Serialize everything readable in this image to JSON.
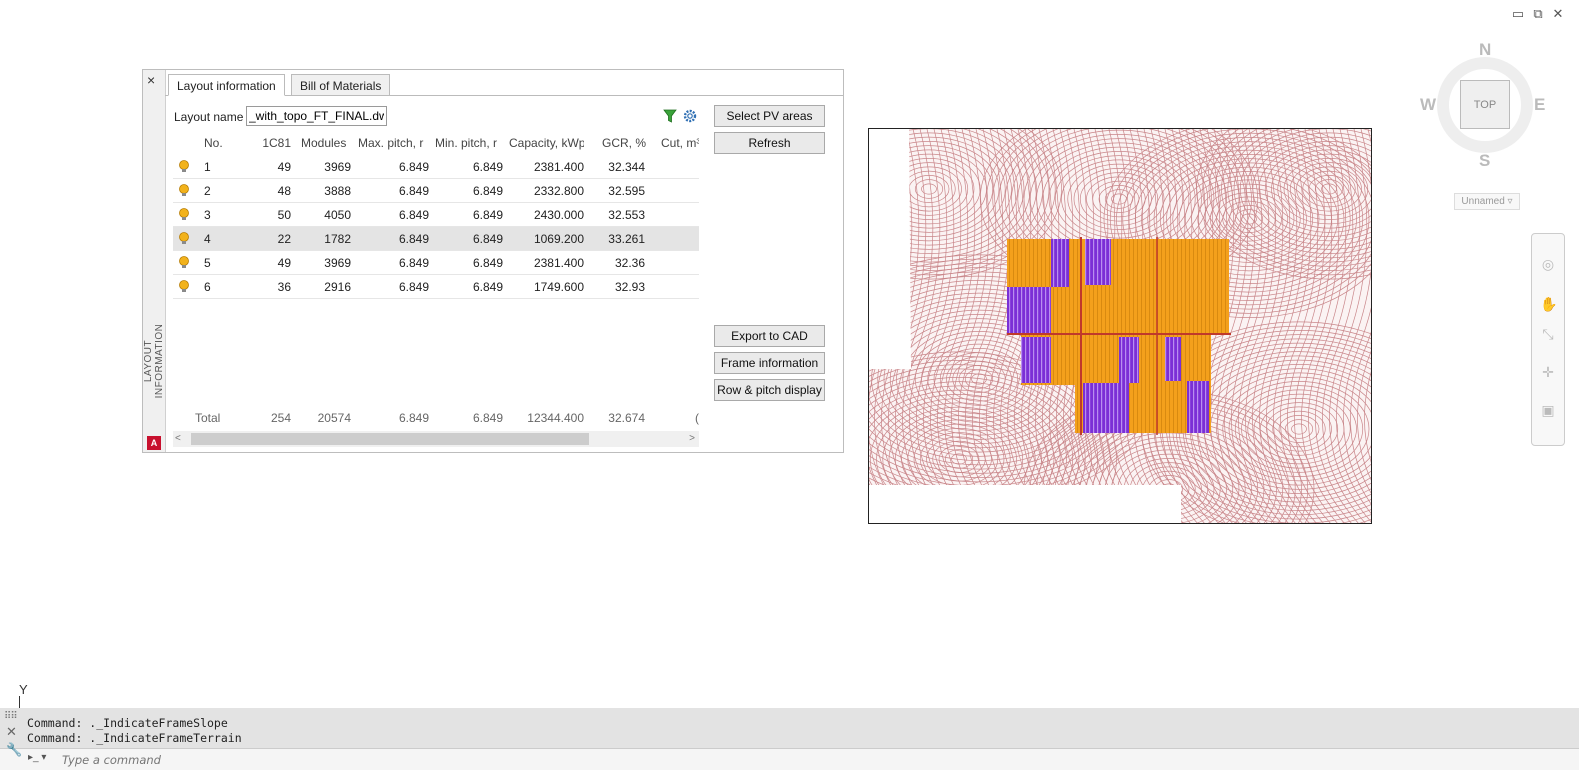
{
  "window_controls": {
    "minimize": "▭",
    "restore": "⧉",
    "close": "✕"
  },
  "palette": {
    "close_glyph": "×",
    "side_title": "LAYOUT INFORMATION",
    "logo": "A",
    "tabs": [
      {
        "label": "Layout information"
      },
      {
        "label": "Bill of Materials"
      }
    ],
    "layout_name_label": "Layout name",
    "layout_name_value": "_with_topo_FT_FINAL.dwg",
    "buttons": {
      "select_pv_areas": "Select PV areas",
      "refresh": "Refresh",
      "export_to_cad": "Export to CAD",
      "frame_information": "Frame information",
      "row_pitch_display": "Row & pitch display"
    },
    "table": {
      "columns": [
        "No.",
        "1C81",
        "Modules",
        "Max. pitch, r",
        "Min. pitch, r",
        "Capacity, kWp",
        "GCR, %",
        "Cut, m³"
      ],
      "rows": [
        [
          "1",
          "49",
          "3969",
          "6.849",
          "6.849",
          "2381.400",
          "32.344"
        ],
        [
          "2",
          "48",
          "3888",
          "6.849",
          "6.849",
          "2332.800",
          "32.595"
        ],
        [
          "3",
          "50",
          "4050",
          "6.849",
          "6.849",
          "2430.000",
          "32.553"
        ],
        [
          "4",
          "22",
          "1782",
          "6.849",
          "6.849",
          "1069.200",
          "33.261"
        ],
        [
          "5",
          "49",
          "3969",
          "6.849",
          "6.849",
          "2381.400",
          "32.36"
        ],
        [
          "6",
          "36",
          "2916",
          "6.849",
          "6.849",
          "1749.600",
          "32.93"
        ]
      ],
      "total": [
        "Total",
        "254",
        "20574",
        "6.849",
        "6.849",
        "12344.400",
        "32.674",
        "("
      ]
    },
    "scroll_left": "<",
    "scroll_right": ">"
  },
  "viewcube": {
    "north": "N",
    "south": "S",
    "east": "E",
    "west": "W",
    "face": "TOP",
    "ucs": "Unnamed ▿"
  },
  "axis_label": "Y",
  "command": {
    "history": [
      "Command: ._IndicateFrameSlope",
      "Command: ._IndicateFrameTerrain"
    ],
    "placeholder": "Type a command",
    "prompt_glyph": "▸_ ▾"
  },
  "colors": {
    "contour": "#c9868a",
    "pv_orange": "#f4a01c",
    "pv_purple": "#7b2fd6",
    "road_red": "#c0392b"
  }
}
